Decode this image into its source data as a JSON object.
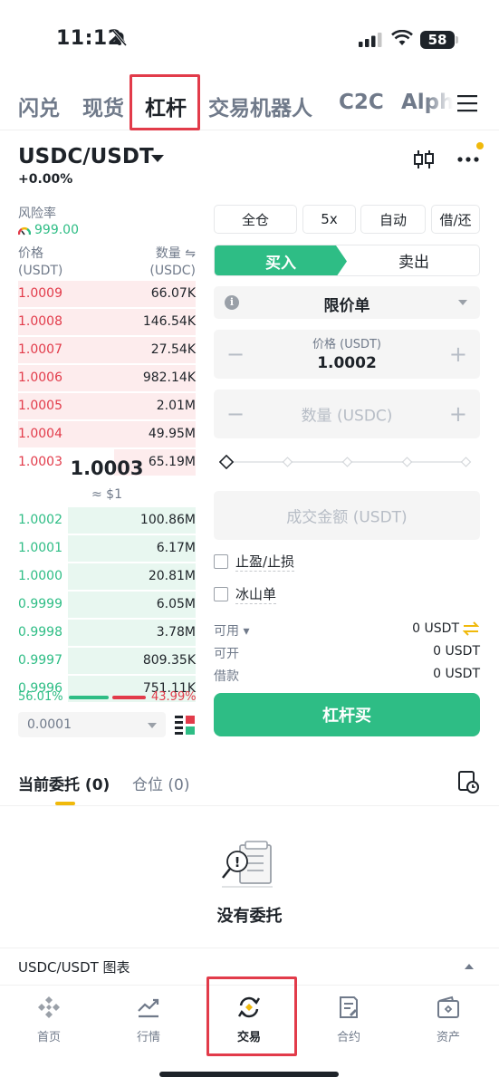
{
  "status_bar": {
    "time": "11:12",
    "battery": "58"
  },
  "top_tabs": [
    "闪兑",
    "现货",
    "杠杆",
    "交易机器人",
    "C2C",
    "Alph"
  ],
  "pair": {
    "name": "USDC/USDT",
    "change": "+0.00%"
  },
  "risk": {
    "label": "风险率",
    "value": "999.00"
  },
  "orderbook": {
    "price_header": "价格",
    "price_unit": "(USDT)",
    "qty_header": "数量 ⇋",
    "qty_unit": "(USDC)",
    "asks": [
      {
        "price": "1.0009",
        "qty": "66.07K",
        "depth": 1.0
      },
      {
        "price": "1.0008",
        "qty": "146.54K",
        "depth": 1.0
      },
      {
        "price": "1.0007",
        "qty": "27.54K",
        "depth": 1.0
      },
      {
        "price": "1.0006",
        "qty": "982.14K",
        "depth": 1.0
      },
      {
        "price": "1.0005",
        "qty": "2.01M",
        "depth": 1.0
      },
      {
        "price": "1.0004",
        "qty": "49.95M",
        "depth": 1.0
      },
      {
        "price": "1.0003",
        "qty": "65.19M",
        "depth": 0.46
      }
    ],
    "mid_price": "1.0003",
    "mid_usd": "≈ $1",
    "bids": [
      {
        "price": "1.0002",
        "qty": "100.86M",
        "depth": 0.72
      },
      {
        "price": "1.0001",
        "qty": "6.17M",
        "depth": 0.72
      },
      {
        "price": "1.0000",
        "qty": "20.81M",
        "depth": 0.72
      },
      {
        "price": "0.9999",
        "qty": "6.05M",
        "depth": 0.72
      },
      {
        "price": "0.9998",
        "qty": "3.78M",
        "depth": 0.72
      },
      {
        "price": "0.9997",
        "qty": "809.35K",
        "depth": 0.72
      },
      {
        "price": "0.9996",
        "qty": "751.11K",
        "depth": 0.72
      }
    ],
    "buy_ratio": "56.01%",
    "sell_ratio": "43.99%",
    "precision": "0.0001"
  },
  "options": {
    "margin_mode": "全仓",
    "leverage": "5x",
    "auto": "自动",
    "borrow": "借/还"
  },
  "side": {
    "buy": "买入",
    "sell": "卖出"
  },
  "order_type": "限价单",
  "price_field": {
    "label": "价格 (USDT)",
    "value": "1.0002"
  },
  "qty_field": {
    "placeholder": "数量 (USDC)"
  },
  "total_field": {
    "placeholder": "成交金额 (USDT)"
  },
  "checkboxes": {
    "tp_sl": "止盈/止损",
    "iceberg": "冰山单"
  },
  "balances": [
    {
      "label": "可用 ▾",
      "value": "0 USDT"
    },
    {
      "label": "可开",
      "value": "0 USDT"
    },
    {
      "label": "借款",
      "value": "0 USDT"
    }
  ],
  "submit": "杠杆买",
  "orders": {
    "tab_open": "当前委托 (0)",
    "tab_positions": "仓位 (0)",
    "empty": "没有委托",
    "chart_link": "USDC/USDT 图表"
  },
  "nav": [
    "首页",
    "行情",
    "交易",
    "合约",
    "资产"
  ],
  "colors": {
    "green": "#2ebd85",
    "red": "#e23b4a",
    "yellow": "#f0b90b"
  }
}
